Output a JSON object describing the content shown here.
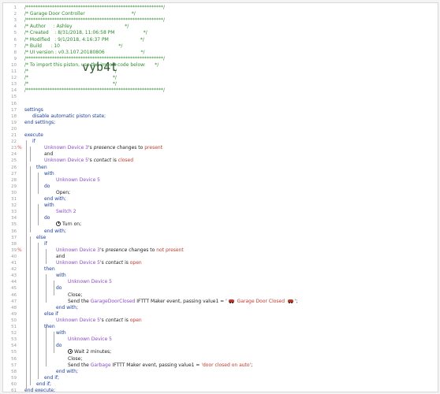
{
  "header": {
    "rule": "/**********************************************************/",
    "title": "/* Garage Door Controller                               */",
    "author": "/* Author     : Ashley                                   */",
    "created": "/* Created    : 8/31/2018, 11:06:58 PM                   */",
    "modified": "/* Modified   : 9/1/2018, 4:16:37 PM                     */",
    "build": "/* Build      : 10                                       */",
    "ui_version": "/* UI version : v0.3.107.20180806                        */",
    "import_note": "/* To import this piston, use the import code below:      */",
    "blank1": "/*                                                        */",
    "blank2": "/*                                                        */",
    "blank3": "/*                                                        */",
    "import_code": "vyb4t"
  },
  "line_numbers": [
    "1",
    "2",
    "3",
    "4",
    "5",
    "6",
    "7",
    "8",
    "9",
    "10",
    "11",
    "12",
    "13",
    "14",
    "15",
    "16",
    "17",
    "18",
    "19",
    "20",
    "21",
    "22",
    "23",
    "24",
    "25",
    "26",
    "27",
    "28",
    "29",
    "30",
    "31",
    "32",
    "33",
    "34",
    "35",
    "36",
    "37",
    "38",
    "39",
    "40",
    "41",
    "42",
    "43",
    "44",
    "45",
    "46",
    "47",
    "48",
    "49",
    "50",
    "51",
    "52",
    "53",
    "54",
    "55",
    "56",
    "57",
    "58",
    "59",
    "60",
    "61"
  ],
  "trigger_marker": "%",
  "code": {
    "settings": "settings",
    "disable": "disable automatic piston state;",
    "end_settings": "end settings;",
    "execute": "execute",
    "if": "if",
    "then": "then",
    "else": "else",
    "else_if": "else if",
    "and": "and",
    "with": "with",
    "do": "do",
    "end_with": "end with;",
    "end_if": "end if;",
    "end_execute": "end execute;",
    "dev3": "Unknown Device 3",
    "dev5": "Unknown Device 5",
    "switch2": "Switch 2",
    "poss": "'s ",
    "presence": "presence",
    "contact": "contact",
    "changes_to": " changes to ",
    "is": " is ",
    "present": "present",
    "not_present": "not present",
    "closed": "closed",
    "open": "open",
    "open_cmd": "Open;",
    "turn_on": "Turn on;",
    "close_cmd": "Close;",
    "send1_a": "Send the ",
    "send1_event": "GarageDoorClosed",
    "send1_b": " IFTTT Maker event, passing value1 = '",
    "send1_value": " Garage Door Closed ",
    "send1_c": "';",
    "wait": "Wait 2 minutes;",
    "send2_event": "Garbage",
    "send2_b": " IFTTT Maker event, passing value1 = ",
    "send2_value": "'door closed on auto'",
    "send2_c": ";"
  }
}
